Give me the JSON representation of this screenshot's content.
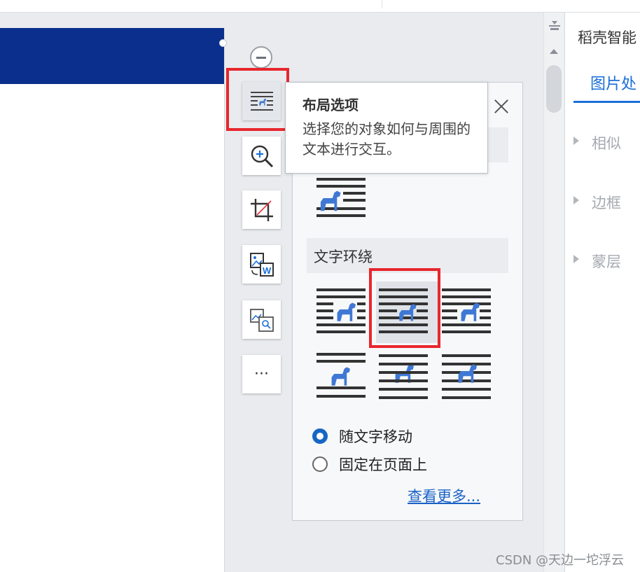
{
  "tooltip": {
    "title": "布局选项",
    "description": "选择您的对象如何与周围的文本进行交互。"
  },
  "layout_panel": {
    "wrap_section_label": "文字环绕",
    "inline_option": "inline-with-text",
    "wrap_options": [
      "square",
      "tight",
      "through",
      "top-and-bottom",
      "behind-text",
      "in-front-of-text"
    ],
    "selected_wrap": "tight",
    "position_options": [
      {
        "label": "随文字移动",
        "checked": true
      },
      {
        "label": "固定在页面上",
        "checked": false
      }
    ],
    "see_more_link": "查看更多..."
  },
  "toolbar": {
    "items": [
      "collapse-icon",
      "layout-options-icon",
      "zoom-in-icon",
      "crop-icon",
      "image-to-word-icon",
      "image-convert-icon",
      "more-icon"
    ],
    "more_label": "···"
  },
  "side_pane": {
    "title": "稻壳智能",
    "active_tab": "图片处",
    "items": [
      "相似",
      "边框",
      "蒙层"
    ]
  },
  "watermark": "CSDN @天边一坨浮云",
  "colors": {
    "accent": "#1a6fd8",
    "horse": "#3f78d4",
    "banner": "#0a2f8c",
    "highlight": "#e8262d"
  }
}
